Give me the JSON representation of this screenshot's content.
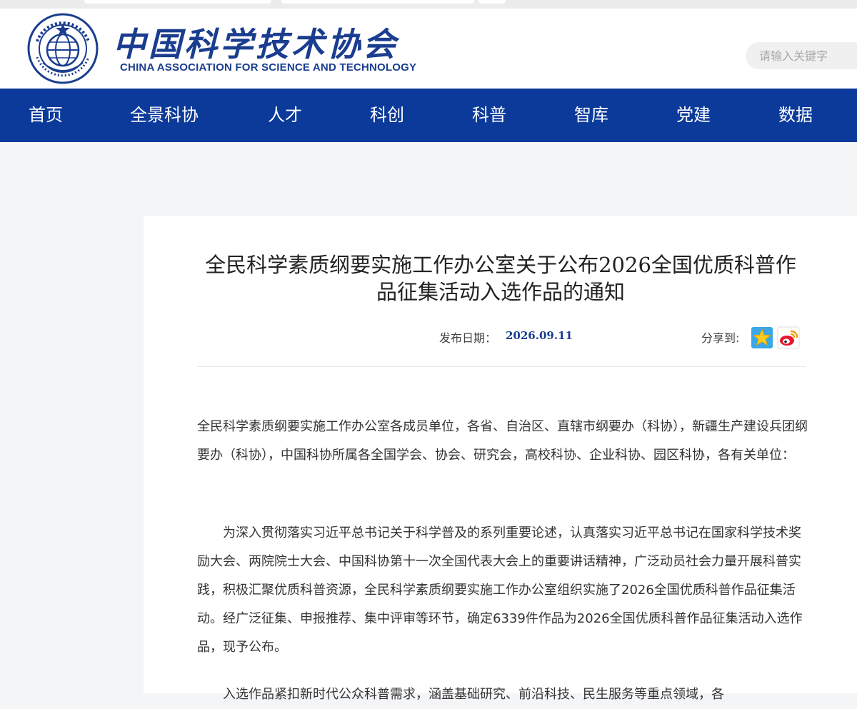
{
  "header": {
    "logo_cn": "中国科学技术协会",
    "logo_en": "CHINA ASSOCIATION FOR SCIENCE AND TECHNOLOGY",
    "emblem_icon": "cast-emblem-icon",
    "search_placeholder": "请输入关键字"
  },
  "nav": {
    "items": [
      "首页",
      "全景科协",
      "人才",
      "科创",
      "科普",
      "智库",
      "党建",
      "数据"
    ]
  },
  "article": {
    "title_line1": "全民科学素质纲要实施工作办公室关于公布2026全国优质科普作",
    "title_line2": "品征集活动入选作品的通知",
    "date_label": "发布日期：",
    "date_value": "2026.09.11",
    "share_label": "分享到:",
    "share_icons": [
      "qzone-star-icon",
      "weibo-icon"
    ],
    "paragraphs": [
      "全民科学素质纲要实施工作办公室各成员单位，各省、自治区、直辖市纲要办（科协），新疆生产建设兵团纲要办（科协），中国科协所属各全国学会、协会、研究会，高校科协、企业科协、园区科协，各有关单位：",
      "为深入贯彻落实习近平总书记关于科学普及的系列重要论述，认真落实习近平总书记在国家科学技术奖励大会、两院院士大会、中国科协第十一次全国代表大会上的重要讲话精神，广泛动员社会力量开展科普实践，积极汇聚优质科普资源，全民科学素质纲要实施工作办公室组织实施了2026全国优质科普作品征集活动。经广泛征集、申报推荐、集中评审等环节，确定6339件作品为2026全国优质科普作品征集活动入选作品，现予公布。",
      "入选作品紧扣新时代公众科普需求，涵盖基础研究、前沿科技、民生服务等重点领域，各"
    ]
  },
  "colors": {
    "nav_bg": "#0b3a9a",
    "brand_blue": "#1a3d8f",
    "page_bg": "#f4f5f7"
  }
}
